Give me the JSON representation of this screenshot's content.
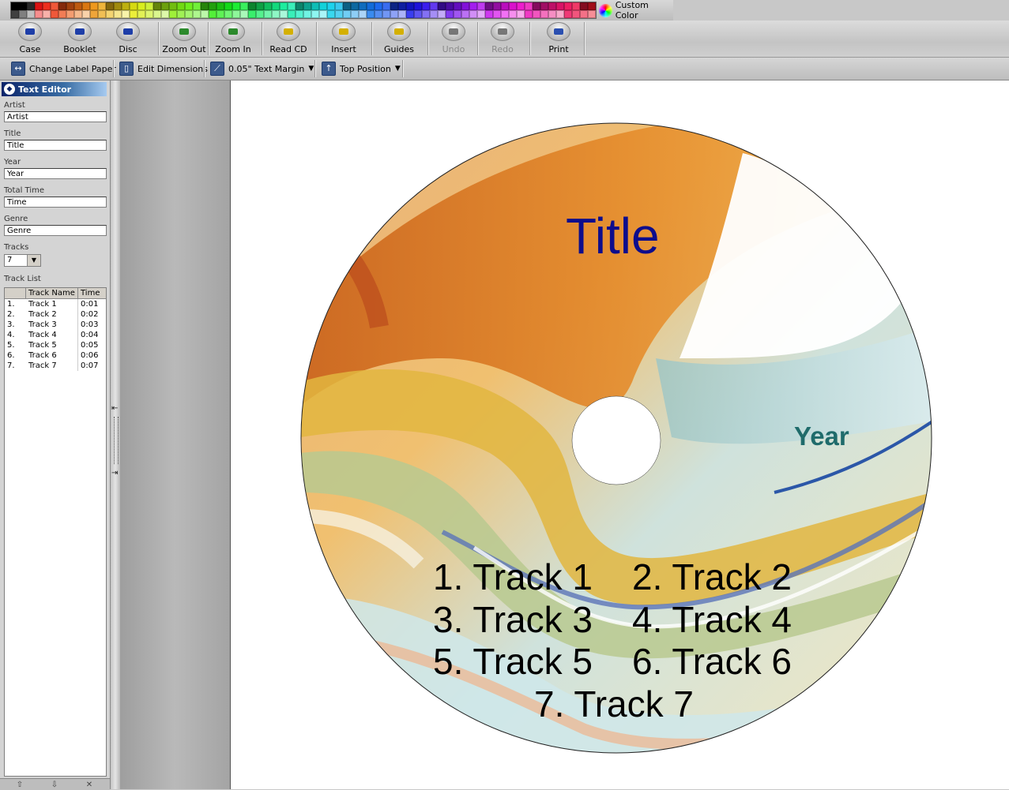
{
  "palette": {
    "custom_color_label": "Custom Color",
    "icon": "color-wheel-icon"
  },
  "toolbar": {
    "buttons": [
      {
        "label": "Case",
        "icon": "case-icon",
        "enabled": true
      },
      {
        "label": "Booklet",
        "icon": "booklet-icon",
        "enabled": true
      },
      {
        "label": "Disc",
        "icon": "disc-icon",
        "enabled": true
      },
      {
        "label": "Zoom Out",
        "icon": "zoom-out-icon",
        "enabled": true
      },
      {
        "label": "Zoom In",
        "icon": "zoom-in-icon",
        "enabled": true
      },
      {
        "label": "Read CD",
        "icon": "read-cd-icon",
        "enabled": true
      },
      {
        "label": "Insert",
        "icon": "insert-icon",
        "enabled": true
      },
      {
        "label": "Guides",
        "icon": "guides-icon",
        "enabled": true
      },
      {
        "label": "Undo",
        "icon": "undo-icon",
        "enabled": false
      },
      {
        "label": "Redo",
        "icon": "redo-icon",
        "enabled": false
      },
      {
        "label": "Print",
        "icon": "print-icon",
        "enabled": true
      }
    ]
  },
  "toolbar2": {
    "change_label_paper": "Change Label Paper",
    "edit_dimensions": "Edit Dimensions",
    "text_margin": "0.05\" Text Margin",
    "position": "Top Position"
  },
  "editor": {
    "title": "Text Editor",
    "artist_label": "Artist",
    "artist_value": "Artist",
    "title_label": "Title",
    "title_value": "Title",
    "year_label": "Year",
    "year_value": "Year",
    "time_label": "Total Time",
    "time_value": "Time",
    "genre_label": "Genre",
    "genre_value": "Genre",
    "tracks_label": "Tracks",
    "tracks_value": "7",
    "track_list_label": "Track List",
    "columns": [
      "",
      "Track Name",
      "Time"
    ],
    "tracks": [
      {
        "num": "1.",
        "name": "Track 1",
        "time": "0:01"
      },
      {
        "num": "2.",
        "name": "Track 2",
        "time": "0:02"
      },
      {
        "num": "3.",
        "name": "Track 3",
        "time": "0:03"
      },
      {
        "num": "4.",
        "name": "Track 4",
        "time": "0:04"
      },
      {
        "num": "5.",
        "name": "Track 5",
        "time": "0:05"
      },
      {
        "num": "6.",
        "name": "Track 6",
        "time": "0:06"
      },
      {
        "num": "7.",
        "name": "Track 7",
        "time": "0:07"
      }
    ]
  },
  "disc": {
    "title": "Title",
    "year": "Year",
    "title_color": "#0d0d8c",
    "year_color": "#1f6b6b",
    "track_lines": [
      [
        "1. Track 1",
        "2. Track 2"
      ],
      [
        "3. Track 3",
        "4. Track 4"
      ],
      [
        "5. Track 5",
        "6. Track 6"
      ],
      [
        "7. Track 7"
      ]
    ]
  }
}
